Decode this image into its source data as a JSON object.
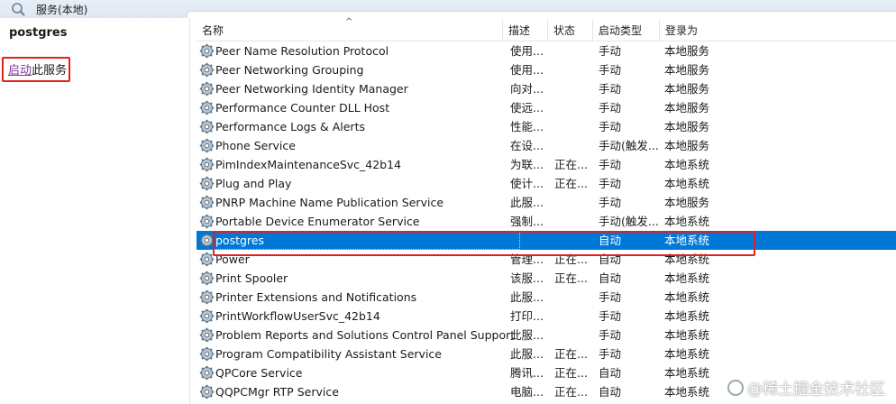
{
  "window": {
    "title": "服务(本地)",
    "icon": "services-icon"
  },
  "left_panel": {
    "service_name": "postgres",
    "start_link": "启动",
    "start_suffix": "此服务"
  },
  "columns": [
    "名称",
    "描述",
    "状态",
    "启动类型",
    "登录为"
  ],
  "rows": [
    {
      "name": "Peer Name Resolution Protocol",
      "desc": "使用...",
      "state": "",
      "type": "手动",
      "logon": "本地服务"
    },
    {
      "name": "Peer Networking Grouping",
      "desc": "使用...",
      "state": "",
      "type": "手动",
      "logon": "本地服务"
    },
    {
      "name": "Peer Networking Identity Manager",
      "desc": "向对...",
      "state": "",
      "type": "手动",
      "logon": "本地服务"
    },
    {
      "name": "Performance Counter DLL Host",
      "desc": "使远...",
      "state": "",
      "type": "手动",
      "logon": "本地服务"
    },
    {
      "name": "Performance Logs & Alerts",
      "desc": "性能...",
      "state": "",
      "type": "手动",
      "logon": "本地服务"
    },
    {
      "name": "Phone Service",
      "desc": "在设...",
      "state": "",
      "type": "手动(触发...",
      "logon": "本地服务"
    },
    {
      "name": "PimIndexMaintenanceSvc_42b14",
      "desc": "为联...",
      "state": "正在...",
      "type": "手动",
      "logon": "本地系统"
    },
    {
      "name": "Plug and Play",
      "desc": "使计...",
      "state": "正在...",
      "type": "手动",
      "logon": "本地系统"
    },
    {
      "name": "PNRP Machine Name Publication Service",
      "desc": "此服...",
      "state": "",
      "type": "手动",
      "logon": "本地服务"
    },
    {
      "name": "Portable Device Enumerator Service",
      "desc": "强制...",
      "state": "",
      "type": "手动(触发...",
      "logon": "本地系统"
    },
    {
      "name": "postgres",
      "desc": "",
      "state": "",
      "type": "自动",
      "logon": "本地系统"
    },
    {
      "name": "Power",
      "desc": "管理...",
      "state": "正在...",
      "type": "自动",
      "logon": "本地系统"
    },
    {
      "name": "Print Spooler",
      "desc": "该服...",
      "state": "正在...",
      "type": "自动",
      "logon": "本地系统"
    },
    {
      "name": "Printer Extensions and Notifications",
      "desc": "此服...",
      "state": "",
      "type": "手动",
      "logon": "本地系统"
    },
    {
      "name": "PrintWorkflowUserSvc_42b14",
      "desc": "打印...",
      "state": "",
      "type": "手动",
      "logon": "本地系统"
    },
    {
      "name": "Problem Reports and Solutions Control Panel Support",
      "desc": "此服...",
      "state": "",
      "type": "手动",
      "logon": "本地系统"
    },
    {
      "name": "Program Compatibility Assistant Service",
      "desc": "此服...",
      "state": "正在...",
      "type": "手动",
      "logon": "本地系统"
    },
    {
      "name": "QPCore Service",
      "desc": "腾讯...",
      "state": "正在...",
      "type": "自动",
      "logon": "本地系统"
    },
    {
      "name": "QQPCMgr RTP Service",
      "desc": "电脑...",
      "state": "正在...",
      "type": "自动",
      "logon": "本地系统"
    }
  ],
  "selected_row": "postgres",
  "watermark": "@稀土掘金技术社区",
  "colors": {
    "selection": "#0078d7",
    "highlight_border": "#e02020",
    "link": "#7c3a9a"
  }
}
